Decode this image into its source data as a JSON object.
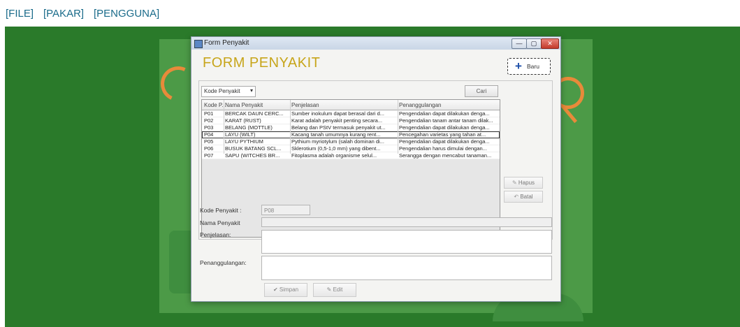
{
  "menu": [
    "[FILE]",
    "[PAKAR]",
    "[PENGGUNA]"
  ],
  "window": {
    "title": "Form Penyakit",
    "controls": [
      "—",
      "▢",
      "✕"
    ]
  },
  "form": {
    "heading": "FORM PENYAKIT",
    "baru_label": "Baru",
    "search_combo_value": "Kode Penyakit",
    "cari_label": "Cari",
    "hapus_label": "Hapus",
    "batal_label": "Batal",
    "simpan_label": "Simpan",
    "edit_label": "Edit"
  },
  "table": {
    "headers": [
      "Kode P...",
      "Nama Penyakit",
      "Penjelasan",
      "Penanggulangan"
    ],
    "rows": [
      [
        "P01",
        "BERCAK DAUN CERC...",
        "Sumber inokulum dapat berasal dari d...",
        "Pengendalian dapat dilakukan denga..."
      ],
      [
        "P02",
        "KARAT (RUST)",
        "Karat adalah penyakit penting secara...",
        "Pengendalian tanam antar tanam dilak..."
      ],
      [
        "P03",
        "BELANG (MOTTLE)",
        "Belang dan PStV termasuk penyakit ut...",
        "Pengendalian dapat dilakukan denga..."
      ],
      [
        "P04",
        "LAYU (WILT)",
        "Kacang tanah umumnya kurang rent...",
        "Pencegahan varietas yang tahan at..."
      ],
      [
        "P05",
        "LAYU PYTHIUM",
        "Pythium myriotylum (salah dominan di...",
        "Pengendalian dapat dilakukan denga..."
      ],
      [
        "P06",
        "BUSUK BATANG SCL...",
        "Sklerotium (0,5-1,0 mm) yang dibent...",
        "Pengendalian harus dimulai dengan..."
      ],
      [
        "P07",
        "SAPU (WITCHES BR...",
        "Fitoplasma adalah organisme selul...",
        "Serangga dengan mencabut tanaman..."
      ]
    ]
  },
  "fields": {
    "kode_label": "Kode Penyakit :",
    "kode_value": "P08",
    "nama_label": "Nama Penyakit",
    "penjelasan_label": "Penjelasan:",
    "penanggulangan_label": "Penanggulangan:"
  }
}
